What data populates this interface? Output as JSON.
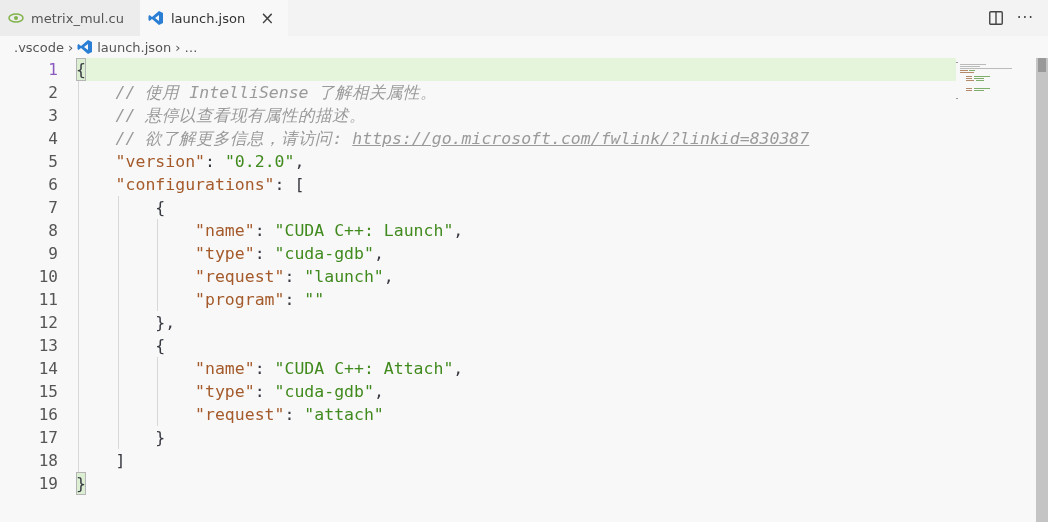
{
  "tabs": [
    {
      "label": "metrix_mul.cu",
      "kind": "cuda",
      "selected": false
    },
    {
      "label": "launch.json",
      "kind": "json",
      "selected": true,
      "close": "×"
    }
  ],
  "more_actions": "···",
  "breadcrumb": [
    {
      "label": ".vscode",
      "kind": "folder"
    },
    {
      "label": "›",
      "kind": "separator"
    },
    {
      "label": "launch.json",
      "kind": "json"
    },
    {
      "label": "›",
      "kind": "separator"
    },
    {
      "label": "…",
      "kind": "folder"
    }
  ],
  "editor": {
    "lines": [
      {
        "number": "1",
        "current": true,
        "tokens": [
          {
            "kind": "bracket",
            "text": "{",
            "matched": true
          }
        ],
        "children": [
          {
            "number": "2",
            "current": false,
            "tokens": [
              {
                "kind": "comment",
                "text": "// 使用 IntelliSense 了解相关属性。"
              }
            ]
          },
          {
            "number": "3",
            "current": false,
            "tokens": [
              {
                "kind": "comment",
                "text": "// 悬停以查看现有属性的描述。"
              }
            ]
          },
          {
            "number": "4",
            "current": false,
            "tokens": [
              {
                "kind": "comment",
                "text": "// 欲了解更多信息，请访问: "
              },
              {
                "kind": "link",
                "text": "https://go.microsoft.com/fwlink/?linkid=830387"
              }
            ]
          },
          {
            "number": "5",
            "current": false,
            "tokens": [
              {
                "kind": "key",
                "text": "\"version\""
              },
              {
                "kind": "punct",
                "text": ": "
              },
              {
                "kind": "string",
                "text": "\"0.2.0\""
              },
              {
                "kind": "punct",
                "text": ","
              }
            ]
          },
          {
            "number": "6",
            "current": false,
            "tokens": [
              {
                "kind": "key",
                "text": "\"configurations\""
              },
              {
                "kind": "punct",
                "text": ": "
              },
              {
                "kind": "bracket",
                "text": "[",
                "matched": false
              }
            ],
            "children": [
              {
                "number": "7",
                "current": false,
                "tokens": [
                  {
                    "kind": "bracket",
                    "text": "{",
                    "matched": false
                  }
                ],
                "children": [
                  {
                    "number": "8",
                    "current": false,
                    "tokens": [
                      {
                        "kind": "key",
                        "text": "\"name\""
                      },
                      {
                        "kind": "punct",
                        "text": ": "
                      },
                      {
                        "kind": "string",
                        "text": "\"CUDA C++: Launch\""
                      },
                      {
                        "kind": "punct",
                        "text": ","
                      }
                    ]
                  },
                  {
                    "number": "9",
                    "current": false,
                    "tokens": [
                      {
                        "kind": "key",
                        "text": "\"type\""
                      },
                      {
                        "kind": "punct",
                        "text": ": "
                      },
                      {
                        "kind": "string",
                        "text": "\"cuda-gdb\""
                      },
                      {
                        "kind": "punct",
                        "text": ","
                      }
                    ]
                  },
                  {
                    "number": "10",
                    "current": false,
                    "tokens": [
                      {
                        "kind": "key",
                        "text": "\"request\""
                      },
                      {
                        "kind": "punct",
                        "text": ": "
                      },
                      {
                        "kind": "string",
                        "text": "\"launch\""
                      },
                      {
                        "kind": "punct",
                        "text": ","
                      }
                    ]
                  },
                  {
                    "number": "11",
                    "current": false,
                    "tokens": [
                      {
                        "kind": "key",
                        "text": "\"program\""
                      },
                      {
                        "kind": "punct",
                        "text": ": "
                      },
                      {
                        "kind": "string",
                        "text": "\"\""
                      }
                    ]
                  }
                ]
              },
              {
                "number": "12",
                "current": false,
                "tokens": [
                  {
                    "kind": "bracket",
                    "text": "},",
                    "matched": false
                  }
                ]
              },
              {
                "number": "13",
                "current": false,
                "tokens": [
                  {
                    "kind": "bracket",
                    "text": "{",
                    "matched": false
                  }
                ],
                "children": [
                  {
                    "number": "14",
                    "current": false,
                    "tokens": [
                      {
                        "kind": "key",
                        "text": "\"name\""
                      },
                      {
                        "kind": "punct",
                        "text": ": "
                      },
                      {
                        "kind": "string",
                        "text": "\"CUDA C++: Attach\""
                      },
                      {
                        "kind": "punct",
                        "text": ","
                      }
                    ]
                  },
                  {
                    "number": "15",
                    "current": false,
                    "tokens": [
                      {
                        "kind": "key",
                        "text": "\"type\""
                      },
                      {
                        "kind": "punct",
                        "text": ": "
                      },
                      {
                        "kind": "string",
                        "text": "\"cuda-gdb\""
                      },
                      {
                        "kind": "punct",
                        "text": ","
                      }
                    ]
                  },
                  {
                    "number": "16",
                    "current": false,
                    "tokens": [
                      {
                        "kind": "key",
                        "text": "\"request\""
                      },
                      {
                        "kind": "punct",
                        "text": ": "
                      },
                      {
                        "kind": "string",
                        "text": "\"attach\""
                      }
                    ]
                  }
                ]
              },
              {
                "number": "17",
                "current": false,
                "tokens": [
                  {
                    "kind": "bracket",
                    "text": "}",
                    "matched": false
                  }
                ]
              }
            ]
          },
          {
            "number": "18",
            "current": false,
            "tokens": [
              {
                "kind": "bracket",
                "text": "]",
                "matched": false
              }
            ]
          }
        ]
      },
      {
        "number": "19",
        "current": false,
        "tokens": [
          {
            "kind": "bracket",
            "text": "}",
            "matched": true
          }
        ]
      }
    ]
  }
}
